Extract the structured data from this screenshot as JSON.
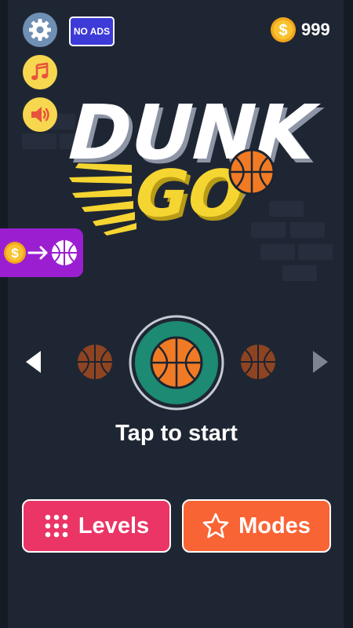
{
  "top_bar": {
    "no_ads_label": "NO ADS",
    "coins": "999"
  },
  "logo": {
    "line1": "DUNK",
    "line2": "GO"
  },
  "ball_selector": {
    "prompt": "Tap to start"
  },
  "buttons": {
    "levels_label": "Levels",
    "modes_label": "Modes"
  },
  "icons": [
    "gear-icon",
    "music-note-icon",
    "speaker-icon",
    "coin-icon",
    "arrow-right-icon",
    "basketball-icon",
    "chevron-left-icon",
    "chevron-right-icon",
    "grid-dots-icon",
    "star-icon"
  ],
  "colors": {
    "background": "#1f2633",
    "accent_yellow": "#f7d74f",
    "no_ads_blue": "#3d3ad8",
    "exchange_purple": "#9b1fd1",
    "levels_pink": "#ea3566",
    "modes_orange": "#f96434",
    "ring_green": "#1d8a73",
    "ball_orange": "#f07b24"
  }
}
